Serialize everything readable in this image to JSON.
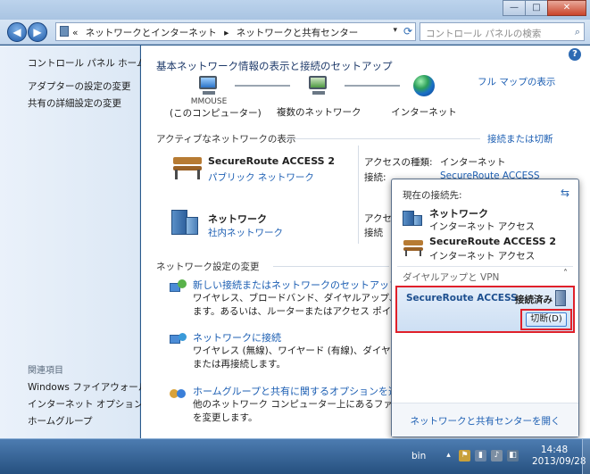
{
  "window": {
    "controls": {
      "minimize": "—",
      "maximize": "□",
      "close": "✕"
    },
    "nav": {
      "back": "◀",
      "forward": "▶"
    },
    "address": {
      "prefix": "«",
      "crumbs": [
        "ネットワークとインターネット",
        "▸",
        "ネットワークと共有センター"
      ],
      "dropdown": "▾",
      "refresh": "⟳"
    },
    "search": {
      "placeholder": "コントロール パネルの検索",
      "icon": "⌕"
    }
  },
  "sidebar": {
    "home": "コントロール パネル ホーム",
    "items": [
      "アダプターの設定の変更",
      "共有の詳細設定の変更"
    ],
    "see_also_header": "関連項目",
    "see_also": [
      "Windows ファイアウォール",
      "インターネット オプション",
      "ホームグループ"
    ]
  },
  "main": {
    "help": "?",
    "title": "基本ネットワーク情報の表示と接続のセットアップ",
    "full_map": "フル マップの表示",
    "map": {
      "computer_name": "MMOUSE",
      "computer_label": "(このコンピューター)",
      "middle": "複数のネットワーク",
      "internet": "インターネット"
    },
    "active_header": "アクティブなネットワークの表示",
    "connect_disconnect": "接続または切断",
    "networks": [
      {
        "name": "SecureRoute ACCESS  2",
        "type": "パブリック ネットワーク",
        "access_label": "アクセスの種類:",
        "access_value": "インターネット",
        "conn_label": "接続:",
        "conn_value": "SecureRoute ACCESS"
      },
      {
        "name": "ネットワーク",
        "type": "社内ネットワーク",
        "access_label": "アクセ",
        "conn_label": "接続"
      }
    ],
    "change_header": "ネットワーク設定の変更",
    "tasks": [
      {
        "title": "新しい接続またはネットワークのセットアップ",
        "desc": [
          "ワイヤレス、ブロードバンド、ダイヤルアップ、アドホ",
          "ます。あるいは、ルーターまたはアクセス ポイントを"
        ]
      },
      {
        "title": "ネットワークに接続",
        "desc": [
          "ワイヤレス (無線)、ワイヤード (有線)、ダイヤルアップ",
          "または再接続します。"
        ]
      },
      {
        "title": "ホームグループと共有に関するオプションを選択する",
        "desc": [
          "他のネットワーク コンピューター上にあるファイルや",
          "を変更します。"
        ]
      }
    ]
  },
  "popup": {
    "current_header": "現在の接続先:",
    "refresh": "⇆",
    "connections": [
      {
        "name": "ネットワーク",
        "sub": "インターネット アクセス"
      },
      {
        "name": "SecureRoute ACCESS  2",
        "sub": "インターネット アクセス"
      }
    ],
    "section": "ダイヤルアップと VPN",
    "section_chevron": "˄",
    "vpn": {
      "name": "SecureRoute ACCESS",
      "status": "接続済み",
      "button": "切断(D)"
    },
    "footer_link": "ネットワークと共有センターを開く"
  },
  "taskbar": {
    "lang": "bin",
    "tray": [
      "▴",
      "⚑",
      "▮",
      "♪",
      "◧"
    ],
    "time": "14:48",
    "date": "2013/09/28"
  }
}
